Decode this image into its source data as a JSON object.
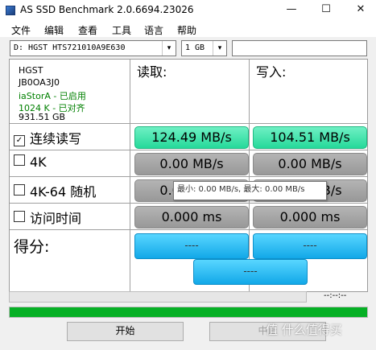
{
  "window": {
    "title": "AS SSD Benchmark 2.0.6694.23026",
    "minimize_glyph": "—",
    "maximize_glyph": "☐",
    "close_glyph": "✕"
  },
  "menu": [
    "文件",
    "编辑",
    "查看",
    "工具",
    "语言",
    "帮助"
  ],
  "toolbar": {
    "drive_value": "D: HGST HTS721010A9E630",
    "size_value": "1 GB",
    "dropdown_glyph": "▾",
    "text_field_value": ""
  },
  "drive_info": {
    "vendor": "HGST",
    "firmware": "JB0OA3J0",
    "driver_status": "iaStorA - 已启用",
    "alignment_status": "1024 K - 已对齐",
    "capacity": "931.51 GB"
  },
  "columns": {
    "read": "读取:",
    "write": "写入:"
  },
  "tests": [
    {
      "checked": true,
      "checkbox_glyph": "✓",
      "label": "连续读写",
      "read": "124.49 MB/s",
      "write": "104.51 MB/s"
    },
    {
      "checked": false,
      "checkbox_glyph": "",
      "label": "4K",
      "read": "0.00 MB/s",
      "write": "0.00 MB/s"
    },
    {
      "checked": false,
      "checkbox_glyph": "",
      "label": "4K-64 随机",
      "read": "0.00 MB/s",
      "write": "0.00 MB/s"
    },
    {
      "checked": false,
      "checkbox_glyph": "",
      "label": "访问时间",
      "read": "0.000 ms",
      "write": "0.000 ms"
    }
  ],
  "score": {
    "label": "得分:",
    "read": "----",
    "write": "----",
    "total": "----"
  },
  "tooltip": "最小: 0.00 MB/s, 最大: 0.00 MB/s",
  "progress": {
    "time_text": "--:--:--",
    "top_bar_fill": 0,
    "main_bar_fill": 1.0
  },
  "buttons": {
    "start": "开始",
    "abort": "中止"
  },
  "watermark": "值 什么值得买",
  "colors": {
    "active_result": "#25d99a",
    "inactive_result": "#989898",
    "score": "#12a8e8",
    "progress": "#06b025",
    "driver_text": "#008000"
  }
}
